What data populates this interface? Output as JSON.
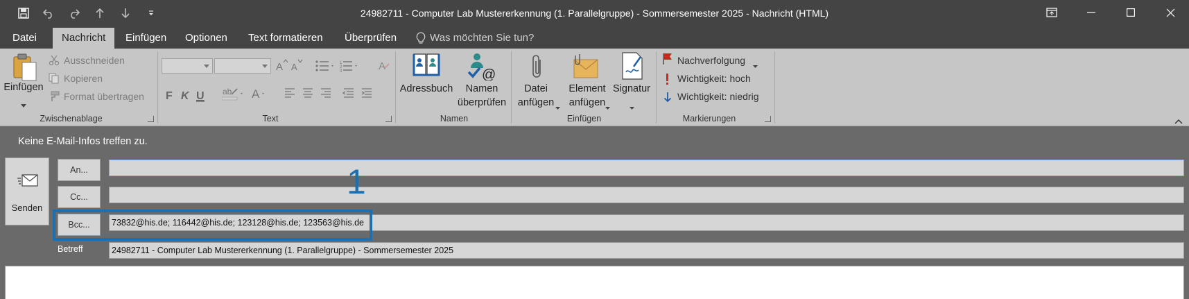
{
  "window": {
    "title": "24982711 - Computer Lab Mustererkennung (1. Parallelgruppe) - Sommersemester 2025 - Nachricht (HTML)"
  },
  "menu": {
    "tabs": [
      {
        "label": "Datei",
        "active": false
      },
      {
        "label": "Nachricht",
        "active": true
      },
      {
        "label": "Einfügen",
        "active": false
      },
      {
        "label": "Optionen",
        "active": false
      },
      {
        "label": "Text formatieren",
        "active": false
      },
      {
        "label": "Überprüfen",
        "active": false
      }
    ],
    "tell_me": "Was möchten Sie tun?"
  },
  "ribbon": {
    "clipboard": {
      "label": "Zwischenablage",
      "paste": "Einfügen",
      "cut": "Ausschneiden",
      "copy": "Kopieren",
      "format_painter": "Format übertragen"
    },
    "text": {
      "label": "Text",
      "bold": "F",
      "italic": "K",
      "underline": "U"
    },
    "names": {
      "label": "Namen",
      "address_book": "Adressbuch",
      "check_names_1": "Namen",
      "check_names_2": "überprüfen"
    },
    "insert": {
      "label": "Einfügen",
      "attach_file_1": "Datei",
      "attach_file_2": "anfügen",
      "attach_item_1": "Element",
      "attach_item_2": "anfügen",
      "signature": "Signatur"
    },
    "tags": {
      "label": "Markierungen",
      "follow_up": "Nachverfolgung",
      "high_importance": "Wichtigkeit: hoch",
      "low_importance": "Wichtigkeit: niedrig"
    }
  },
  "message": {
    "info": "Keine E-Mail-Infos treffen zu.",
    "send_label": "Senden",
    "to_button": "An...",
    "cc_button": "Cc...",
    "bcc_button": "Bcc...",
    "to_value": "",
    "cc_value": "",
    "bcc_value": "73832@his.de; 116442@his.de; 123128@his.de; 123563@his.de",
    "subject_label": "Betreff",
    "subject_value": "24982711 - Computer Lab Mustererkennung (1. Parallelgruppe) - Sommersemester 2025",
    "annotation_marker": "1"
  },
  "colors": {
    "titlebar": "#444444",
    "ribbon": "#c6c6c6",
    "canvas": "#6a6a6a",
    "highlight": "#1f6fae"
  }
}
